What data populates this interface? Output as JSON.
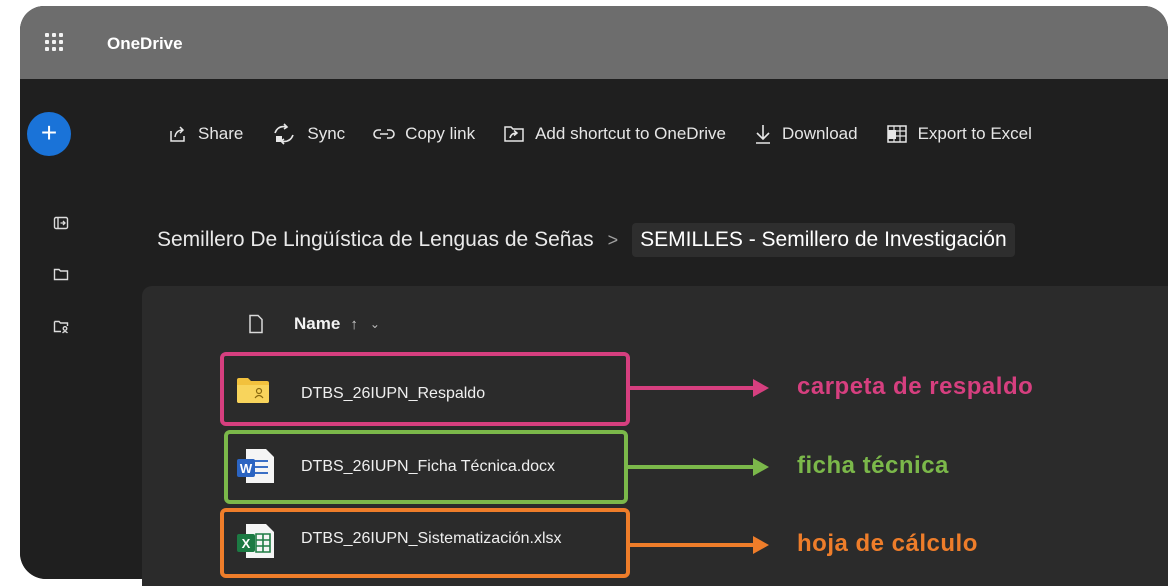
{
  "app": {
    "title": "OneDrive"
  },
  "rail": {
    "new_label": "+",
    "icons": [
      "open-pane-icon",
      "folder-icon",
      "shared-folder-icon"
    ]
  },
  "commands": [
    {
      "label": "Share",
      "icon": "share-icon"
    },
    {
      "label": "Sync",
      "icon": "sync-icon"
    },
    {
      "label": "Copy link",
      "icon": "link-icon"
    },
    {
      "label": "Add shortcut to OneDrive",
      "icon": "shortcut-icon"
    },
    {
      "label": "Download",
      "icon": "download-icon"
    },
    {
      "label": "Export to Excel",
      "icon": "excel-export-icon"
    }
  ],
  "breadcrumb": {
    "parent": "Semillero De Lingüística de Lenguas de Señas",
    "separator": ">",
    "current": "SEMILLES - Semillero de Investigación"
  },
  "list": {
    "header": {
      "name_label": "Name",
      "sort_indicator": "↑",
      "chevron": "⌄"
    },
    "files": [
      {
        "name": "DTBS_26IUPN_Respaldo",
        "type": "folder",
        "annotation": "carpeta de respaldo",
        "color": "#d63f7f"
      },
      {
        "name": "DTBS_26IUPN_Ficha Técnica.docx",
        "type": "word",
        "annotation": "ficha técnica",
        "color": "#7bb84a"
      },
      {
        "name": "DTBS_26IUPN_Sistematización.xlsx",
        "type": "excel",
        "annotation": "hoja de cálculo",
        "color": "#ee7d2a"
      }
    ]
  }
}
